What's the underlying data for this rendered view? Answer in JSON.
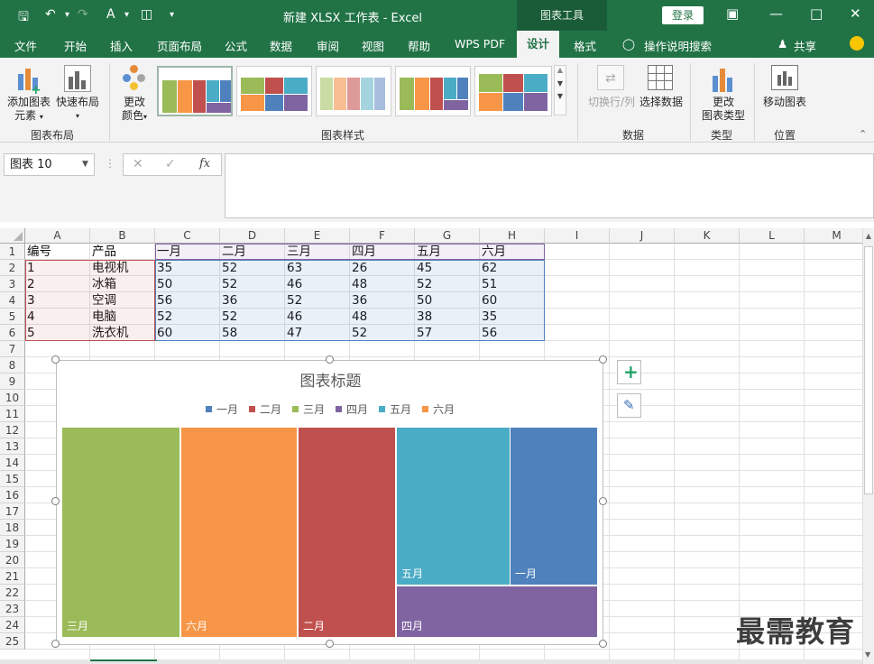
{
  "titlebar": {
    "title": "新建 XLSX 工作表  -  Excel",
    "chart_tools": "图表工具",
    "login": "登录"
  },
  "menu": [
    "文件",
    "开始",
    "插入",
    "页面布局",
    "公式",
    "数据",
    "审阅",
    "视图",
    "帮助",
    "WPS PDF",
    "设计",
    "格式",
    "操作说明搜索",
    "共享"
  ],
  "ribbon": {
    "add_element": "添加图表",
    "add_element2": "元素",
    "quick_layout": "快速布局",
    "change_colors": "更改",
    "change_colors2": "颜色",
    "group_layout": "图表布局",
    "group_styles": "图表样式",
    "switch_row_col": "切换行/列",
    "select_data": "选择数据",
    "group_data": "数据",
    "change_type": "更改",
    "change_type2": "图表类型",
    "group_type": "类型",
    "move_chart": "移动图表",
    "group_location": "位置"
  },
  "formula": {
    "namebox": "图表 10",
    "fx": "fx",
    "value": ""
  },
  "columns": [
    "A",
    "B",
    "C",
    "D",
    "E",
    "F",
    "G",
    "H",
    "I",
    "J",
    "K",
    "L",
    "M"
  ],
  "rows": [
    "1",
    "2",
    "3",
    "4",
    "5",
    "6",
    "7",
    "8",
    "9",
    "10",
    "11",
    "12",
    "13",
    "14",
    "15",
    "16",
    "17",
    "18",
    "19",
    "20",
    "21",
    "22",
    "23",
    "24",
    "25"
  ],
  "table": {
    "headers": [
      "编号",
      "产品",
      "一月",
      "二月",
      "三月",
      "四月",
      "五月",
      "六月"
    ],
    "data": [
      [
        "1",
        "电视机",
        "35",
        "52",
        "63",
        "26",
        "45",
        "62"
      ],
      [
        "2",
        "冰箱",
        "50",
        "52",
        "46",
        "48",
        "52",
        "51"
      ],
      [
        "3",
        "空调",
        "56",
        "36",
        "52",
        "36",
        "50",
        "60"
      ],
      [
        "4",
        "电脑",
        "52",
        "52",
        "46",
        "48",
        "38",
        "35"
      ],
      [
        "5",
        "洗衣机",
        "60",
        "58",
        "47",
        "52",
        "57",
        "56"
      ]
    ]
  },
  "chart_data": {
    "type": "treemap",
    "title": "图表标题",
    "legend": [
      {
        "name": "一月",
        "color": "#4f81bd"
      },
      {
        "name": "二月",
        "color": "#c0504d"
      },
      {
        "name": "三月",
        "color": "#9bbb59"
      },
      {
        "name": "四月",
        "color": "#8064a2"
      },
      {
        "name": "五月",
        "color": "#4bacc6"
      },
      {
        "name": "六月",
        "color": "#f79646"
      }
    ],
    "tiles": [
      {
        "label": "三月",
        "color": "#9bbb59"
      },
      {
        "label": "六月",
        "color": "#f79646"
      },
      {
        "label": "二月",
        "color": "#c0504d"
      },
      {
        "label": "五月",
        "color": "#4bacc6"
      },
      {
        "label": "一月",
        "color": "#4f81bd"
      },
      {
        "label": "四月",
        "color": "#8064a2"
      }
    ]
  },
  "watermark": "最需教育"
}
